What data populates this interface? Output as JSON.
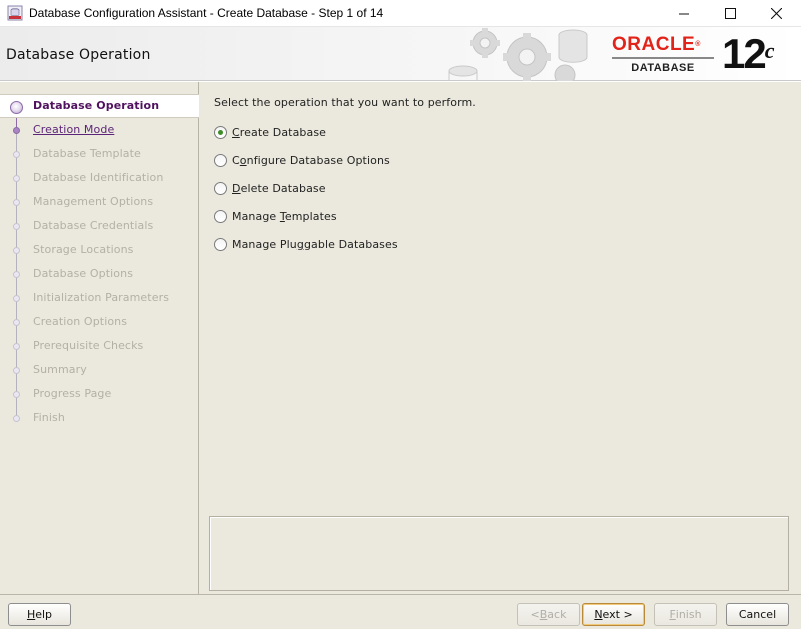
{
  "window": {
    "title": "Database Configuration Assistant - Create Database - Step 1 of 14",
    "icon": "dbca-app-icon",
    "controls": {
      "minimize": "—",
      "maximize": "☐",
      "close": "✕"
    }
  },
  "header": {
    "page_title": "Database Operation",
    "brand": {
      "oracle": "ORACLE",
      "registered": "®",
      "product": "DATABASE",
      "version": "12",
      "version_suffix": "c"
    }
  },
  "steps": [
    {
      "label": "Database Operation",
      "state": "current"
    },
    {
      "label": "Creation Mode",
      "state": "link"
    },
    {
      "label": "Database Template",
      "state": "disabled"
    },
    {
      "label": "Database Identification",
      "state": "disabled"
    },
    {
      "label": "Management Options",
      "state": "disabled"
    },
    {
      "label": "Database Credentials",
      "state": "disabled"
    },
    {
      "label": "Storage Locations",
      "state": "disabled"
    },
    {
      "label": "Database Options",
      "state": "disabled"
    },
    {
      "label": "Initialization Parameters",
      "state": "disabled"
    },
    {
      "label": "Creation Options",
      "state": "disabled"
    },
    {
      "label": "Prerequisite Checks",
      "state": "disabled"
    },
    {
      "label": "Summary",
      "state": "disabled"
    },
    {
      "label": "Progress Page",
      "state": "disabled"
    },
    {
      "label": "Finish",
      "state": "disabled"
    }
  ],
  "main": {
    "prompt": "Select the operation that you want to perform.",
    "options": [
      {
        "label": "Create Database",
        "mnemonic_index": 0,
        "checked": true
      },
      {
        "label": "Configure Database Options",
        "mnemonic_index": 1,
        "checked": false
      },
      {
        "label": "Delete Database",
        "mnemonic_index": 0,
        "checked": false
      },
      {
        "label": "Manage Templates",
        "mnemonic_index": 7,
        "checked": false
      },
      {
        "label": "Manage Pluggable Databases",
        "mnemonic_index": 10,
        "checked": false
      }
    ]
  },
  "buttons": {
    "help": {
      "label": "Help",
      "mnemonic_index": 0
    },
    "back": {
      "label": "< Back",
      "mnemonic_index": 2,
      "enabled": false
    },
    "next": {
      "label": "Next >",
      "mnemonic_index": 0,
      "enabled": true
    },
    "finish": {
      "label": "Finish",
      "mnemonic_index": 0,
      "enabled": false
    },
    "cancel": {
      "label": "Cancel",
      "mnemonic_index": -1
    }
  },
  "colors": {
    "panel_bg": "#ebe9dd",
    "step_current_text": "#50125f",
    "step_link_text": "#5c2579",
    "step_disabled_text": "#b3b0a5",
    "radio_checked": "#3e8d29",
    "oracle_red": "#e2231a"
  }
}
